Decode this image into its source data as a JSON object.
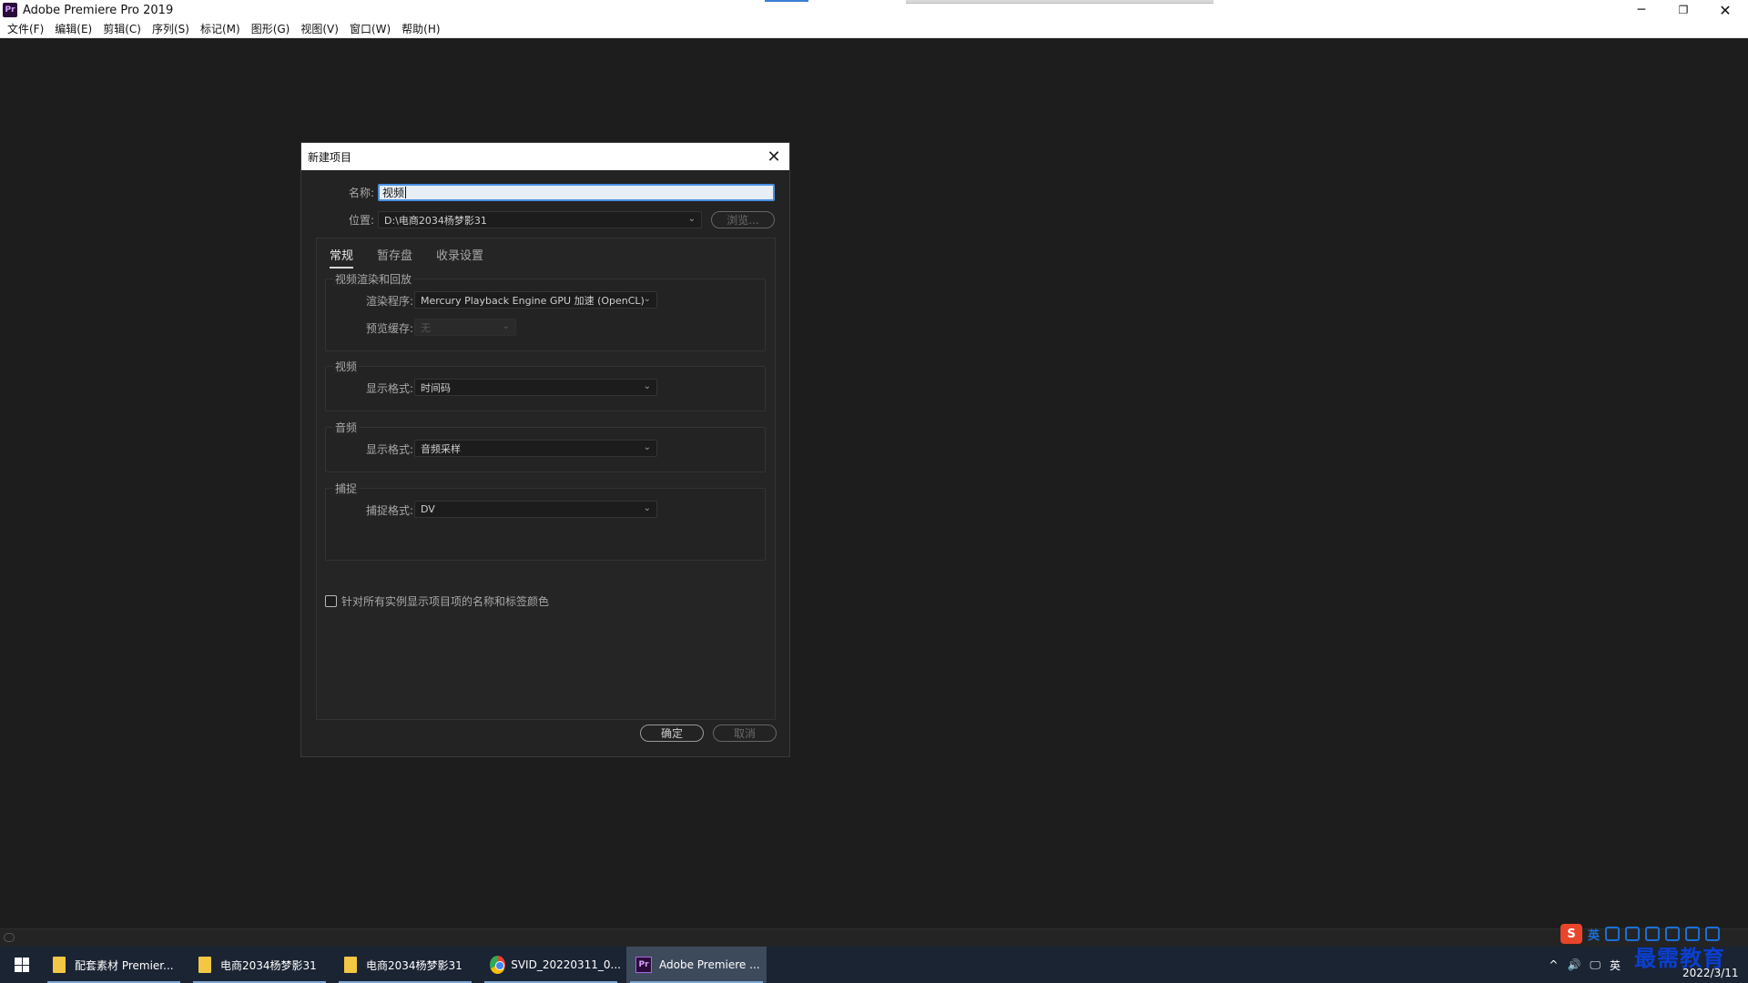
{
  "window": {
    "title": "Adobe Premiere Pro 2019",
    "app_icon": "Pr",
    "controls": {
      "minimize": "─",
      "maximize": "❐",
      "close": "✕"
    }
  },
  "menubar": [
    "文件(F)",
    "编辑(E)",
    "剪辑(C)",
    "序列(S)",
    "标记(M)",
    "图形(G)",
    "视图(V)",
    "窗口(W)",
    "帮助(H)"
  ],
  "dialog": {
    "title": "新建项目",
    "close": "✕",
    "name_label": "名称:",
    "name_value": "视频",
    "location_label": "位置:",
    "location_value": "D:\\电商2034杨梦影31",
    "browse_button": "浏览...",
    "tabs": [
      "常规",
      "暂存盘",
      "收录设置"
    ],
    "active_tab": "常规",
    "groups": {
      "render": {
        "title": "视频渲染和回放",
        "renderer_label": "渲染程序:",
        "renderer_value": "Mercury Playback Engine GPU 加速 (OpenCL)",
        "preview_cache_label": "预览缓存:",
        "preview_cache_value": "无"
      },
      "video": {
        "title": "视频",
        "display_format_label": "显示格式:",
        "display_format_value": "时间码"
      },
      "audio": {
        "title": "音频",
        "display_format_label": "显示格式:",
        "display_format_value": "音频采样"
      },
      "capture": {
        "title": "捕捉",
        "capture_format_label": "捕捉格式:",
        "capture_format_value": "DV"
      }
    },
    "checkbox_label": "针对所有实例显示项目项的名称和标签颜色",
    "checkbox_checked": false,
    "ok_button": "确定",
    "cancel_button": "取消"
  },
  "taskbar": {
    "items": [
      {
        "label": "配套素材 Premier...",
        "icon": "folder-icon"
      },
      {
        "label": "电商2034杨梦影31",
        "icon": "folder-icon"
      },
      {
        "label": "电商2034杨梦影31",
        "icon": "folder-icon"
      },
      {
        "label": "SVID_20220311_0...",
        "icon": "chrome-icon"
      },
      {
        "label": "Adobe Premiere ...",
        "icon": "premiere-icon"
      }
    ],
    "active_index": 4,
    "tray": {
      "caret": "^",
      "volume": "🔊",
      "network": "🖵",
      "lang": "英"
    },
    "date": "2022/3/11",
    "watermark": "最需教育"
  },
  "ime": {
    "logo": "S",
    "mode": "英"
  },
  "colors": {
    "accent": "#4a90e2",
    "dialog_bg": "#232323",
    "workspace_bg": "#1d1d1d",
    "taskbar_bg": "#1a2433"
  }
}
